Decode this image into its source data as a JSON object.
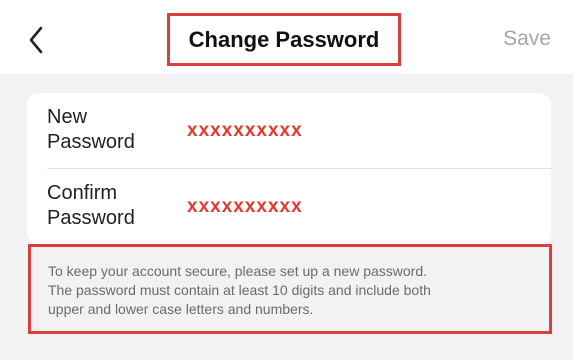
{
  "nav": {
    "back_icon": "chevron-left-icon",
    "title": "Change Password",
    "save_label": "Save"
  },
  "form": {
    "new_password_label_line1": "New",
    "new_password_label_line2": "Password",
    "new_password_value": "xxxxxxxxxx",
    "confirm_password_label_line1": "Confirm",
    "confirm_password_label_line2": "Password",
    "confirm_password_value": "xxxxxxxxxx"
  },
  "hint": {
    "line1": "To keep your account secure, please set up a new password.",
    "line2": "The password must contain at least 10 digits and include both",
    "line3": "upper and lower case letters and numbers."
  },
  "colors": {
    "highlight_border": "#d9403a",
    "masked_value": "#e23a2e",
    "save_disabled": "#a6a6a6",
    "background": "#f2f2f4"
  }
}
